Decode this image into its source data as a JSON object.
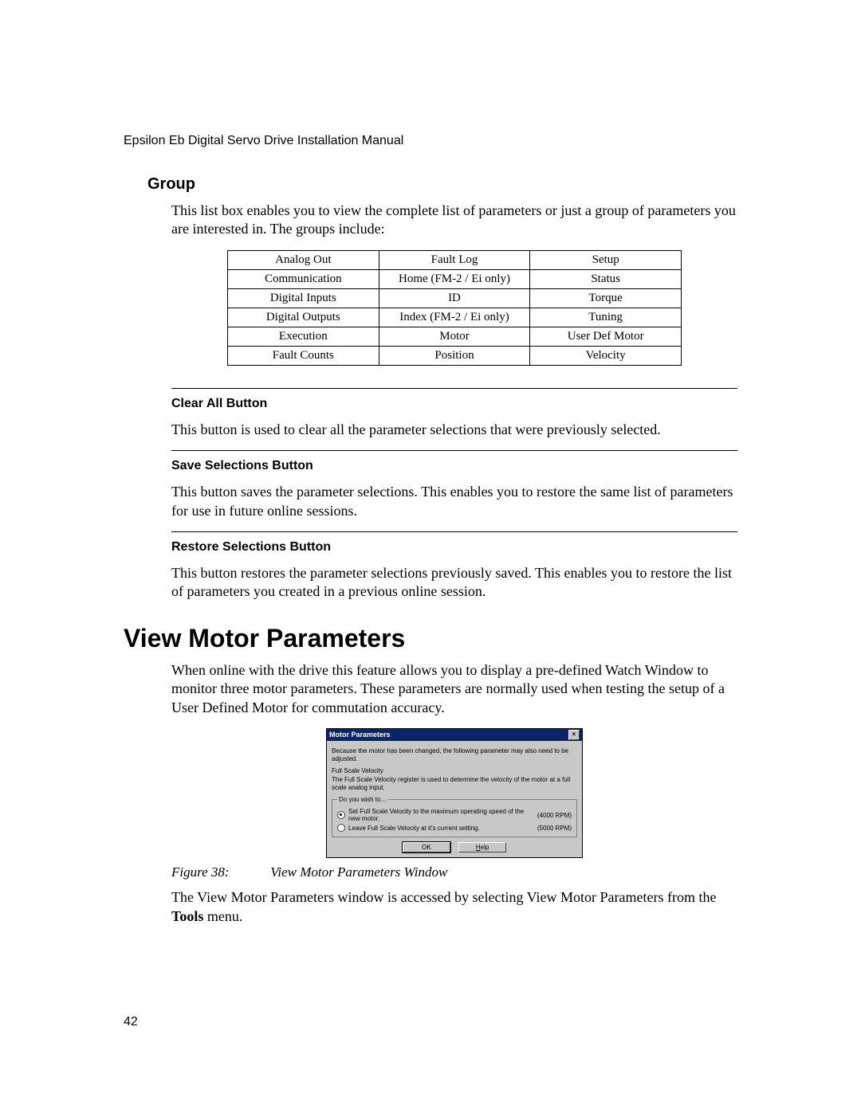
{
  "header": "Epsilon Eb Digital Servo Drive Installation Manual",
  "group": {
    "title": "Group",
    "intro": "This list box enables you to view the complete list of parameters or just a group of parameters you are interested in. The groups include:",
    "table": {
      "rows": [
        [
          "Analog Out",
          "Fault Log",
          "Setup"
        ],
        [
          "Communication",
          "Home (FM-2 / Ei only)",
          "Status"
        ],
        [
          "Digital Inputs",
          "ID",
          "Torque"
        ],
        [
          "Digital Outputs",
          "Index (FM-2 / Ei only)",
          "Tuning"
        ],
        [
          "Execution",
          "Motor",
          "User Def Motor"
        ],
        [
          "Fault Counts",
          "Position",
          "Velocity"
        ]
      ]
    }
  },
  "clearAll": {
    "title": "Clear All Button",
    "text": "This button is used to clear all the parameter selections that were previously selected."
  },
  "saveSel": {
    "title": "Save Selections Button",
    "text": "This button saves the parameter selections. This enables you to restore the same list of parameters for use in future online sessions."
  },
  "restoreSel": {
    "title": "Restore Selections Button",
    "text": "This button restores the parameter selections previously saved. This enables you to restore the list of parameters you created in a previous online session."
  },
  "vmp": {
    "title": "View Motor Parameters",
    "intro": "When online with the drive this feature allows you to display a pre-defined Watch Window to monitor three motor parameters. These parameters are normally used when testing the setup of a User Defined Motor for commutation accuracy.",
    "dialog": {
      "title": "Motor Parameters",
      "msg": "Because the motor has been changed, the following parameter may also need to be adjusted.",
      "sectionLabel": "Full Scale Velocity",
      "desc": "The Full Scale Velocity register is used to determine the velocity of the motor at a full scale analog input.",
      "legend": "Do you wish to…",
      "opt1": "Set Full Scale Velocity to the maximum operating speed of the new motor.",
      "opt1val": "(4000 RPM)",
      "opt2": "Leave Full Scale Velocity at it's current setting.",
      "opt2val": "(5000 RPM)",
      "ok": "OK",
      "help": "Help"
    },
    "figNum": "Figure 38:",
    "figCap": "View Motor Parameters Window",
    "after1": "The View Motor Parameters window is accessed by selecting View Motor Parameters from the ",
    "toolsBold": "Tools",
    "after2": " menu."
  },
  "pageNum": "42"
}
